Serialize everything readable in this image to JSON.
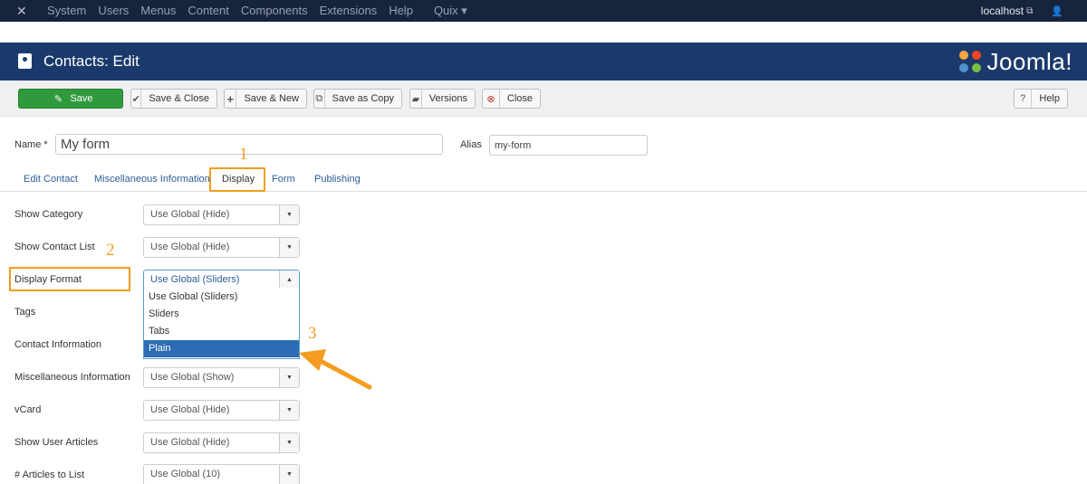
{
  "topnav": {
    "logo_icon": "joomla-x-icon",
    "menu": [
      "System",
      "Users",
      "Menus",
      "Content",
      "Components",
      "Extensions",
      "Help",
      "Quix ▾"
    ],
    "host": "localhost",
    "ext_icon": "external-link-icon",
    "user_icon": "user-icon"
  },
  "title": {
    "text": "Contacts: Edit",
    "brand": "Joomla!"
  },
  "toolbar": {
    "save": "Save",
    "save_close": "Save & Close",
    "save_new": "Save & New",
    "save_copy": "Save as Copy",
    "versions": "Versions",
    "close": "Close",
    "help": "Help"
  },
  "form": {
    "name_label": "Name *",
    "name_value": "My form",
    "alias_label": "Alias",
    "alias_value": "my-form"
  },
  "tabs": [
    "Edit Contact",
    "Miscellaneous Information",
    "Display",
    "Form",
    "Publishing"
  ],
  "annotations": [
    "1",
    "2",
    "3"
  ],
  "fields": [
    {
      "label": "Show Category",
      "value": "Use Global (Hide)"
    },
    {
      "label": "Show Contact List",
      "value": "Use Global (Hide)"
    },
    {
      "label": "Display Format",
      "value": "Use Global (Sliders)"
    },
    {
      "label": "Tags",
      "value": ""
    },
    {
      "label": "Contact Information",
      "value": ""
    },
    {
      "label": "Miscellaneous Information",
      "value": "Use Global (Show)"
    },
    {
      "label": "vCard",
      "value": "Use Global (Hide)"
    },
    {
      "label": "Show User Articles",
      "value": "Use Global (Hide)"
    },
    {
      "label": "# Articles to List",
      "value": "Use Global (10)"
    }
  ],
  "dropdown_options": [
    "Use Global (Sliders)",
    "Sliders",
    "Tabs",
    "Plain"
  ],
  "dropdown_selected": "Plain",
  "colors": {
    "nav": "#17243e",
    "titlebar": "#1b3a6b",
    "save_green": "#2f9a3b",
    "annotation_orange": "#f39c1f",
    "option_highlight": "#2d6cb5"
  }
}
